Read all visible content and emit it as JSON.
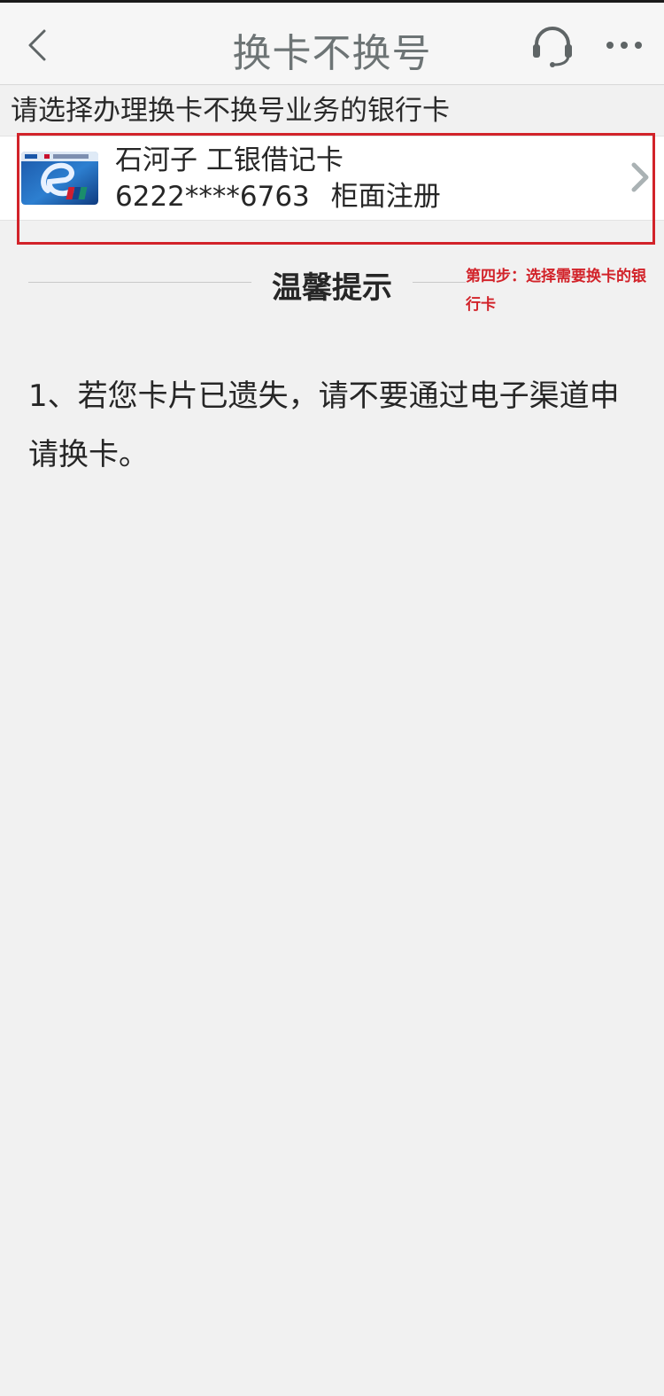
{
  "header": {
    "title": "换卡不换号",
    "back_icon": "chevron-left-icon",
    "service_icon": "headset-icon",
    "more_icon": "more-icon"
  },
  "select_hint": "请选择办理换卡不换号业务的银行卡",
  "card": {
    "region": "石河子",
    "type": "工银借记卡",
    "number": "6222****6763",
    "status": "柜面注册",
    "card_icon": "bank-card-icon"
  },
  "annotation": {
    "text": "第四步：选择需要换卡的银行卡",
    "color": "#d2232a"
  },
  "tips": {
    "title": "温馨提示",
    "items": [
      "1、若您卡片已遗失，请不要通过电子渠道申请换卡。"
    ]
  },
  "colors": {
    "background": "#f1f1f1",
    "title": "#6d7475",
    "text": "#262626"
  }
}
